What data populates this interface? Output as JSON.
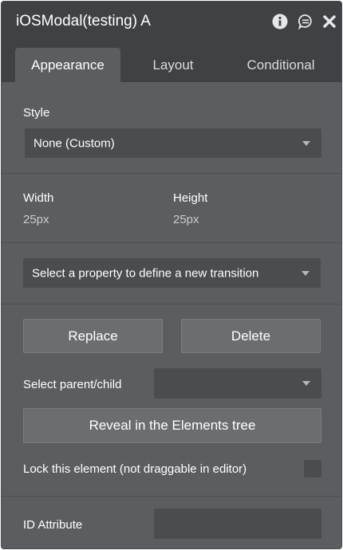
{
  "window": {
    "title": "iOSModal(testing) A",
    "icons": [
      "info-icon",
      "comment-icon",
      "close-icon"
    ]
  },
  "tabs": [
    {
      "label": "Appearance",
      "active": true
    },
    {
      "label": "Layout",
      "active": false
    },
    {
      "label": "Conditional",
      "active": false
    }
  ],
  "style": {
    "label": "Style",
    "selected": "None (Custom)"
  },
  "dimensions": {
    "width_label": "Width",
    "width_value": "25px",
    "height_label": "Height",
    "height_value": "25px"
  },
  "transition": {
    "placeholder": "Select a property to define a new transition"
  },
  "buttons": {
    "replace": "Replace",
    "delete": "Delete",
    "reveal": "Reveal in the Elements tree"
  },
  "parent_child": {
    "label": "Select parent/child",
    "selected": ""
  },
  "lock": {
    "label": "Lock this element (not draggable in editor)",
    "checked": false
  },
  "id_attribute": {
    "label": "ID Attribute",
    "value": ""
  },
  "colors": {
    "panel_bg": "#5b5e60",
    "header_bg": "#3f4244",
    "field_bg": "#4a4d4f",
    "button_bg": "#6b6e70"
  }
}
